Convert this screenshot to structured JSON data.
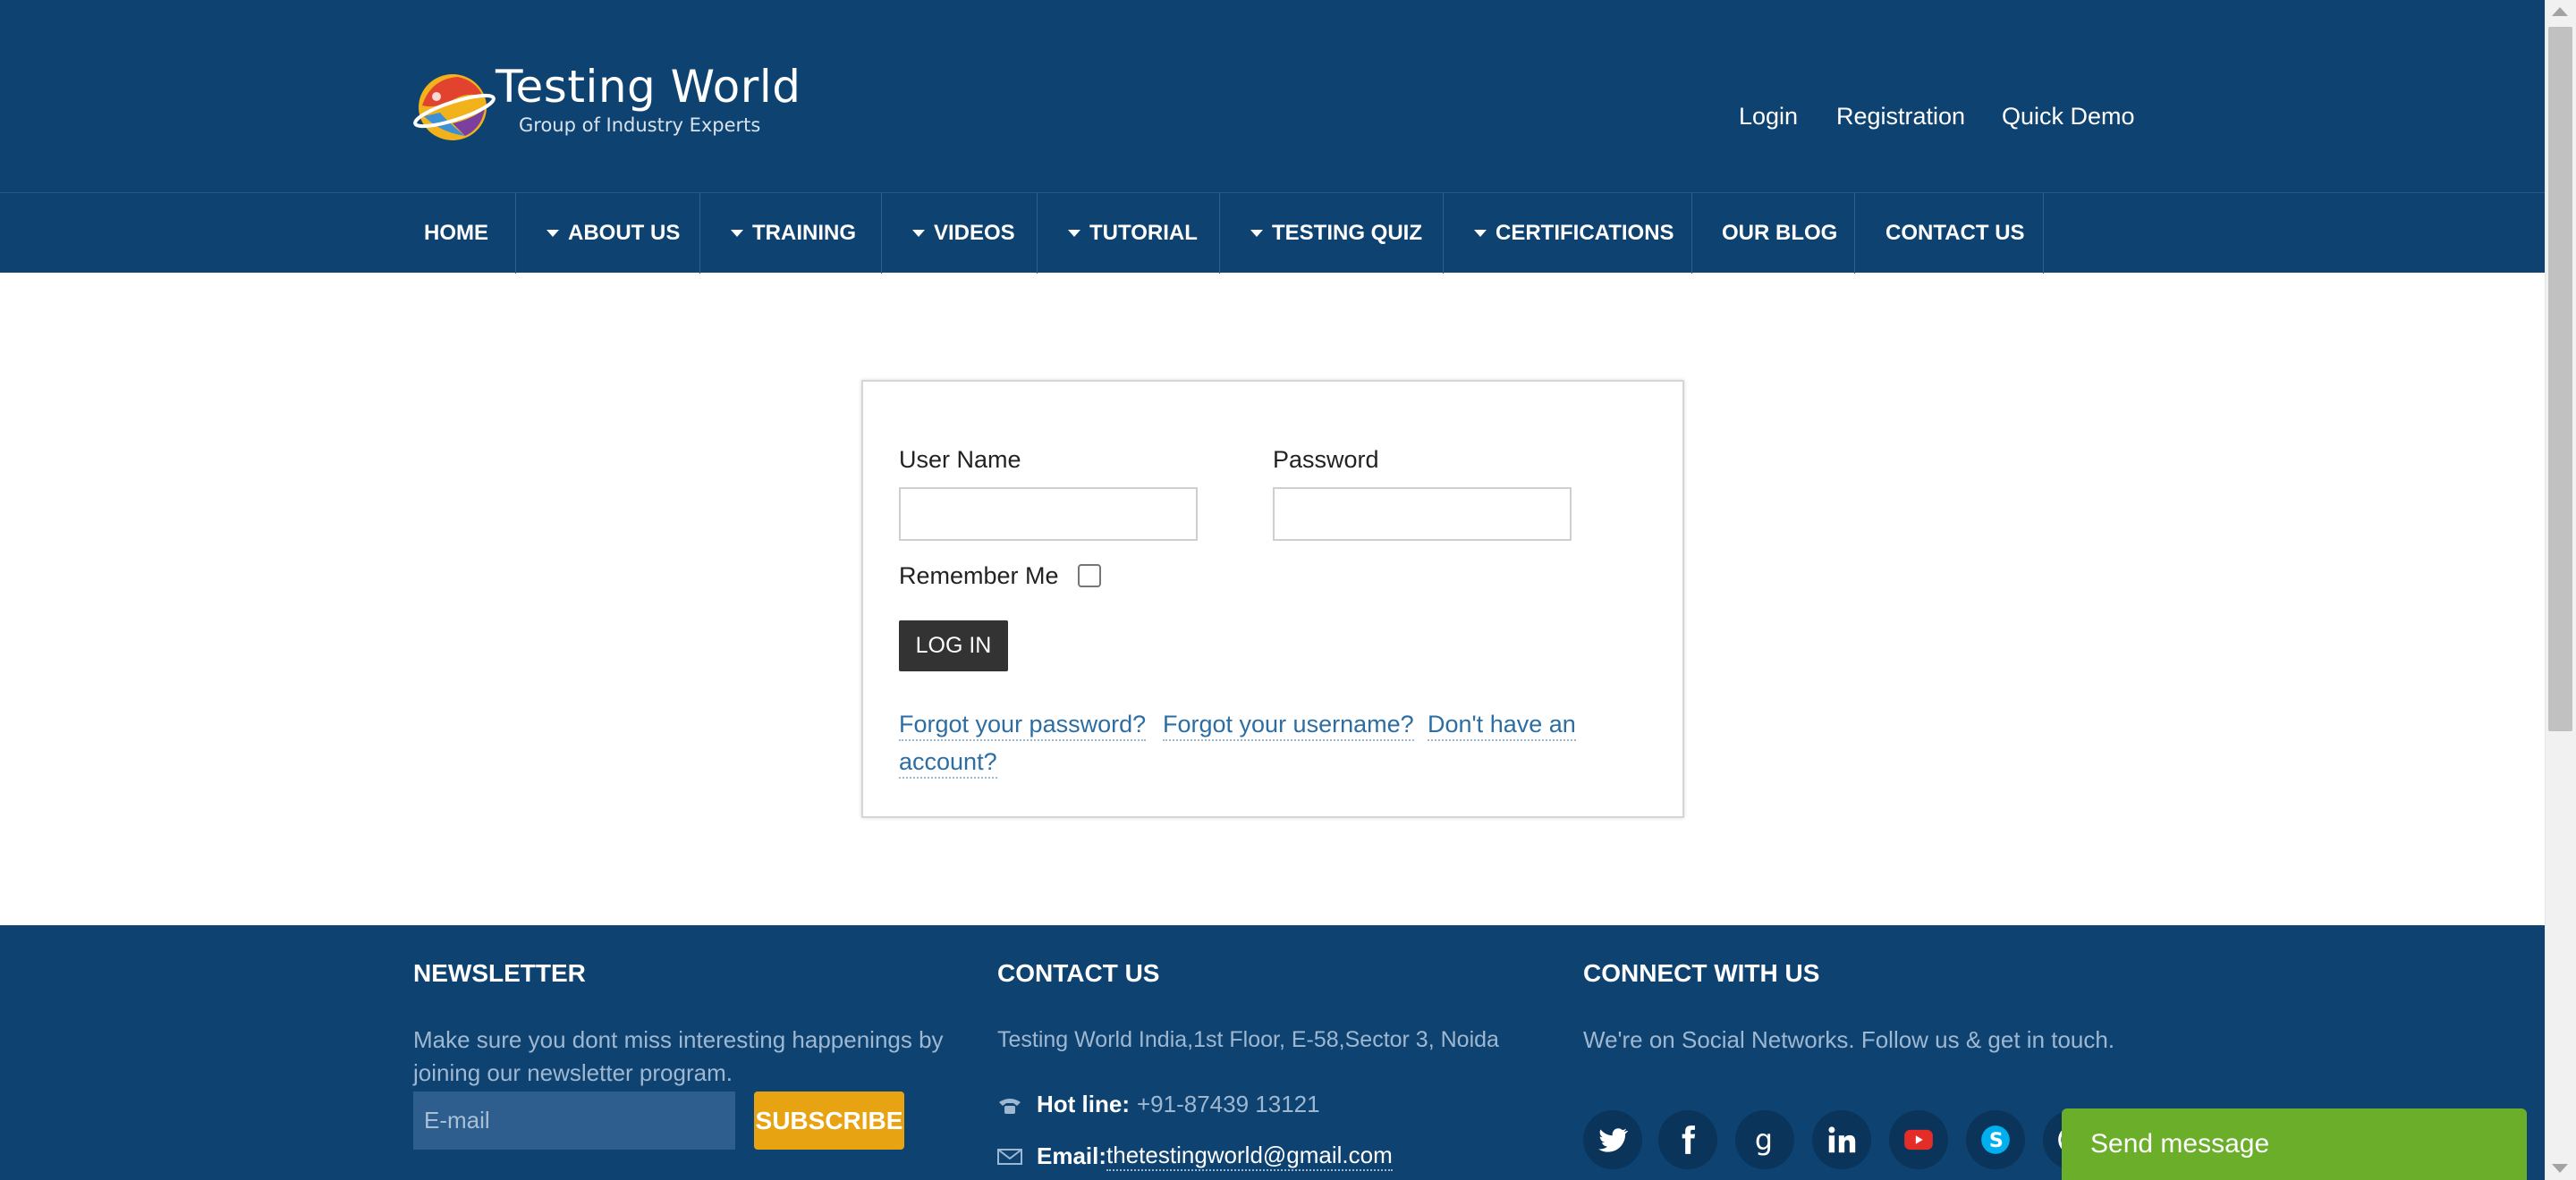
{
  "header": {
    "logo_title": "Testing World",
    "logo_subtitle": "Group of Industry Experts",
    "top_links": [
      "Login",
      "Registration",
      "Quick Demo"
    ]
  },
  "nav": {
    "items": [
      {
        "label": "HOME",
        "has_caret": false
      },
      {
        "label": "ABOUT US",
        "has_caret": true
      },
      {
        "label": "TRAINING",
        "has_caret": true
      },
      {
        "label": "VIDEOS",
        "has_caret": true
      },
      {
        "label": "TUTORIAL",
        "has_caret": true
      },
      {
        "label": "TESTING QUIZ",
        "has_caret": true
      },
      {
        "label": "CERTIFICATIONS",
        "has_caret": true
      },
      {
        "label": "OUR BLOG",
        "has_caret": false
      },
      {
        "label": "CONTACT US",
        "has_caret": false
      }
    ]
  },
  "login": {
    "username_label": "User Name",
    "username_value": "",
    "password_label": "Password",
    "password_value": "",
    "remember_label": "Remember Me",
    "remember_checked": false,
    "login_button": "LOG IN",
    "forgot_password": "Forgot your password?",
    "forgot_username": "Forgot your username?",
    "no_account_line1": "Don't have an",
    "no_account_line2": "account?"
  },
  "footer": {
    "newsletter": {
      "heading": "NEWSLETTER",
      "text": "Make sure you dont miss interesting happenings by joining our newsletter program.",
      "email_placeholder": "E-mail",
      "subscribe_button": "SUBSCRIBE"
    },
    "contact": {
      "heading": "CONTACT US",
      "address": "Testing World India,1st Floor, E-58,Sector 3, Noida",
      "hotline_label": "Hot line:",
      "hotline_value": "+91-87439 13121",
      "email_label": "Email:",
      "email_value": "thetestingworld@gmail.com"
    },
    "connect": {
      "heading": "CONNECT WITH US",
      "text": "We're on Social Networks. Follow us & get in touch.",
      "socials": [
        "twitter-icon",
        "facebook-icon",
        "google-icon",
        "linkedin-icon",
        "youtube-icon",
        "skype-icon",
        "whatsapp-icon"
      ]
    }
  },
  "widget": {
    "send_message": "Send message"
  },
  "colors": {
    "header_bg": "#0e4270",
    "subscribe": "#e8a312",
    "send_message": "#6aae2a",
    "link": "#2c6ea4",
    "login_button": "#333333"
  }
}
